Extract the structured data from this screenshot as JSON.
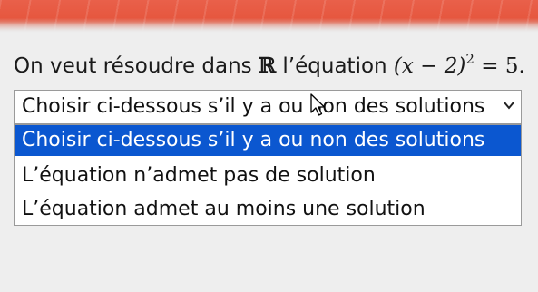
{
  "question": {
    "prefix": "On veut résoudre dans",
    "set_symbol": "ℝ",
    "middle": "l’équation",
    "equation_base": "(x − 2)",
    "equation_exponent": "2",
    "equation_rhs": "= 5."
  },
  "select": {
    "current_value": "Choisir ci-dessous s’il y a ou non des solutions",
    "options": [
      "Choisir ci-dessous s’il y a ou non des solutions",
      "L’équation n’admet pas de solution",
      "L’équation admet au moins une solution"
    ],
    "selected_index": 0
  },
  "icons": {
    "dropdown": "chevron-down-icon",
    "pointer": "mouse-cursor-icon"
  },
  "colors": {
    "banner": "#e6573f",
    "highlight": "#0b57d0",
    "highlight_text": "#ffffff",
    "background": "#eeeeee"
  }
}
